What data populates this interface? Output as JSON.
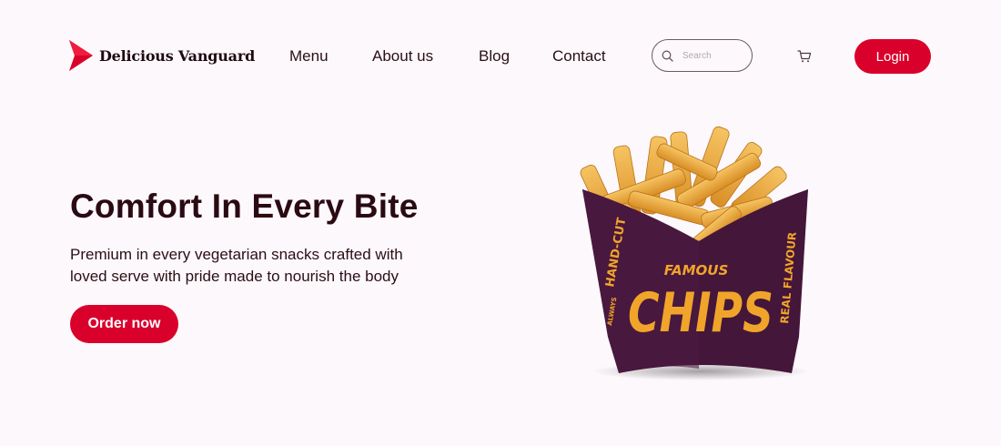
{
  "brand": {
    "name": "Delicious Vanguard",
    "logo_icon": "red-arrow-logo-icon",
    "color": "#d9002b"
  },
  "nav": {
    "menu": "Menu",
    "about": "About us",
    "blog": "Blog",
    "contact": "Contact"
  },
  "search": {
    "placeholder": "Search",
    "icon": "search-icon"
  },
  "cart": {
    "icon": "cart-icon"
  },
  "login_label": "Login",
  "hero": {
    "title": "Comfort In Every Bite",
    "text_line1": "Premium in every vegetarian snacks crafted with",
    "text_line2": "loved serve with pride made to nourish the body",
    "cta_label": "Order now"
  },
  "product": {
    "box_top": "FAMOUS",
    "box_main": "CHIPS",
    "box_left": "HAND-CUT",
    "box_left_small": "ALWAYS",
    "box_right": "REAL FLAVOUR",
    "box_color": "#44163a",
    "text_color": "#f0a52a"
  },
  "colors": {
    "accent": "#d9002b",
    "background": "#fdf8fb",
    "text": "#2a0f16"
  }
}
